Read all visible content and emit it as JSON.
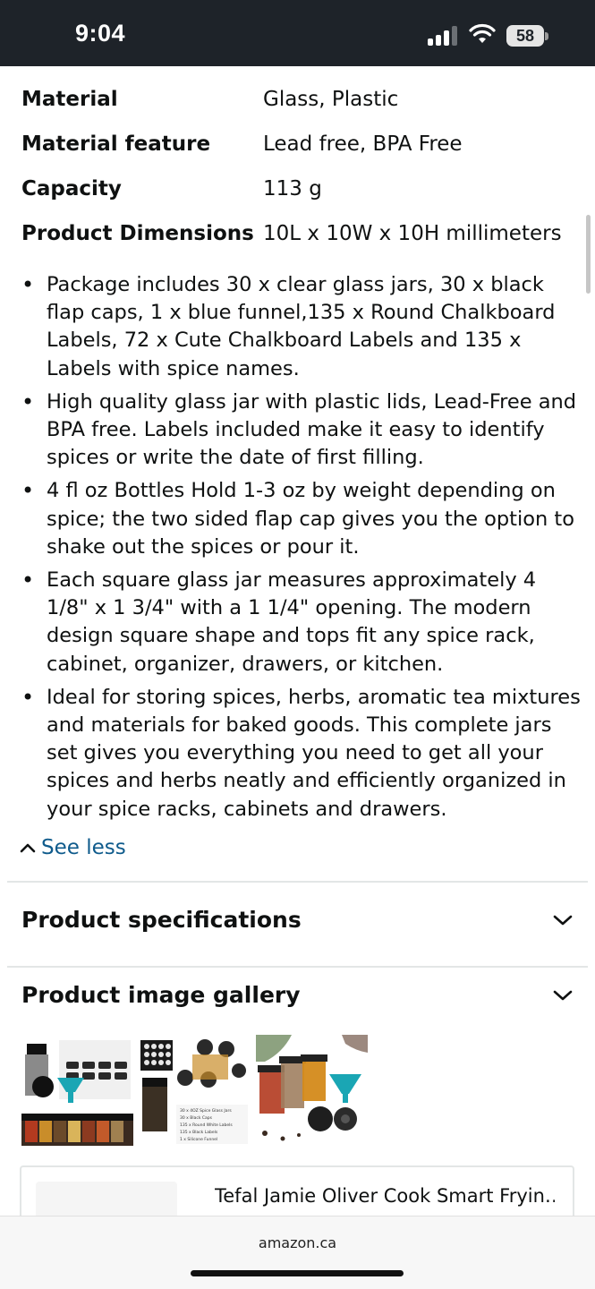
{
  "status_bar": {
    "time": "9:04",
    "battery": "58"
  },
  "specs": [
    {
      "label": "Material",
      "value": "Glass, Plastic"
    },
    {
      "label": "Material feature",
      "value": "Lead free, BPA Free"
    },
    {
      "label": "Capacity",
      "value": "113 g"
    },
    {
      "label": "Product Dimensions",
      "value": "10L x 10W x 10H millimeters"
    }
  ],
  "bullets": [
    "Package includes 30 x clear glass jars, 30 x black flap caps, 1 x blue funnel,135 x Round Chalkboard Labels, 72 x Cute Chalkboard Labels and 135 x Labels with spice names.",
    "High quality glass jar with plastic lids, Lead-Free and BPA free. Labels included make it easy to identify spices or write the date of first filling.",
    "4 fl oz Bottles Hold 1-3 oz by weight depending on spice; the two sided flap cap gives you the option to shake out the spices or pour it.",
    "Each square glass jar measures approximately 4 1/8\" x 1 3/4\" with a 1 1/4\" opening. The modern design square shape and tops fit any spice rack, cabinet, organizer, drawers, or kitchen.",
    "Ideal for storing spices, herbs, aromatic tea mixtures and materials for baked goods. This complete jars set gives you everything you need to get all your spices and herbs neatly and efficiently organized in your spice racks, cabinets and drawers."
  ],
  "see_less": "See less",
  "sections": {
    "specifications": "Product specifications",
    "gallery": "Product image gallery"
  },
  "gallery_thumb_text": [
    "30 x 4OZ Spice Glass Jars",
    "30 x Black Caps",
    "135 x Round White Labels",
    "135 x Black Labels",
    "1 x Silicone Funnel"
  ],
  "related_product": {
    "title": "Tefal Jamie Oliver Cook Smart Fryin…"
  },
  "browser": {
    "url": "amazon.ca"
  },
  "colors": {
    "link": "#0f5b8c",
    "status_bar": "#1e2329",
    "divider": "#e3e6e6"
  }
}
